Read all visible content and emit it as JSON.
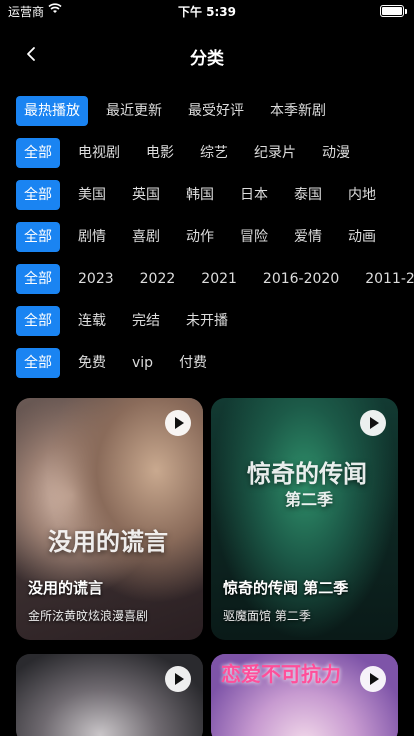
{
  "status": {
    "carrier": "运营商",
    "time": "下午 5:39",
    "battery_level": 1.0
  },
  "header": {
    "title": "分类"
  },
  "filters": {
    "sort": [
      "最热播放",
      "最近更新",
      "最受好评",
      "本季新剧"
    ],
    "type": [
      "全部",
      "电视剧",
      "电影",
      "综艺",
      "纪录片",
      "动漫"
    ],
    "region": [
      "全部",
      "美国",
      "英国",
      "韩国",
      "日本",
      "泰国",
      "内地"
    ],
    "genre": [
      "全部",
      "剧情",
      "喜剧",
      "动作",
      "冒险",
      "爱情",
      "动画"
    ],
    "year": [
      "全部",
      "2023",
      "2022",
      "2021",
      "2016-2020",
      "2011-2"
    ],
    "status": [
      "全部",
      "连载",
      "完结",
      "未开播"
    ],
    "fee": [
      "全部",
      "免费",
      "vip",
      "付费"
    ]
  },
  "cards": [
    {
      "title": "没用的谎言",
      "subtitle": "金所泫黄旼炫浪漫喜剧",
      "poster_text": "没用的谎言"
    },
    {
      "title": "惊奇的传闻 第二季",
      "subtitle": "驱魔面馆 第二季",
      "poster_text": "惊奇的传闻",
      "poster_sub": "第二季"
    },
    {
      "title": "",
      "subtitle": ""
    },
    {
      "title": "",
      "subtitle": "",
      "poster_text": "恋爱不可抗力"
    }
  ],
  "colors": {
    "accent": "#1a84f2",
    "background": "#000000"
  }
}
